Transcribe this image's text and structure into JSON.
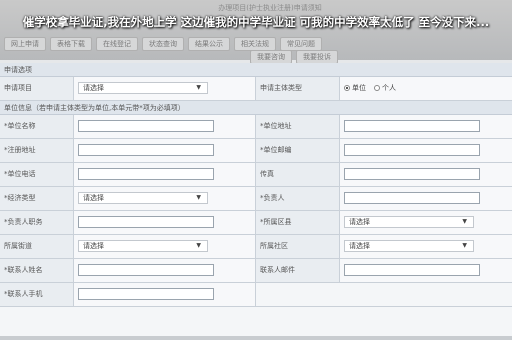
{
  "header": {
    "doc_title": "办理项目(护士执业注册)申请须知",
    "nav_row1": [
      "网上申请",
      "表格下载",
      "在线登记",
      "状态查询",
      "结果公示",
      "相关法规",
      "常见问题"
    ],
    "nav_row2": [
      "我要咨询",
      "我要投诉"
    ]
  },
  "overlay": {
    "headline": "催学校拿毕业证,我在外地上学 这边催我的中学毕业证 可我的中学效率太低了 至今没下来..."
  },
  "form": {
    "section1_title": "申请选项",
    "apply_item_label": "申请项目",
    "apply_item_value": "请选择",
    "subject_type_label": "申请主体类型",
    "subject_options": [
      "单位",
      "个人"
    ],
    "section2_title": "单位信息（若申请主体类型为单位,本单元带*项为必填项）",
    "rows": [
      {
        "left_label": "*单位名称",
        "right_label": "*单位地址"
      },
      {
        "left_label": "*注册地址",
        "right_label": "*单位邮编"
      },
      {
        "left_label": "*单位电话",
        "right_label": "传真"
      },
      {
        "left_label": "*经济类型",
        "left_select": "请选择",
        "right_label": "*负责人"
      },
      {
        "left_label": "*负责人职务",
        "right_label": "*所属区县",
        "right_select": "请选择"
      },
      {
        "left_label": "所属街道",
        "left_select": "请选择",
        "right_label": "所属社区",
        "right_select": "请选择"
      },
      {
        "left_label": "*联系人姓名",
        "right_label": "联系人邮件"
      },
      {
        "left_label": "*联系人手机"
      }
    ]
  },
  "colors": {
    "section_bg": "#dfe5ec",
    "label_bg": "#e9edf1",
    "headline_text": "#ffffff"
  }
}
